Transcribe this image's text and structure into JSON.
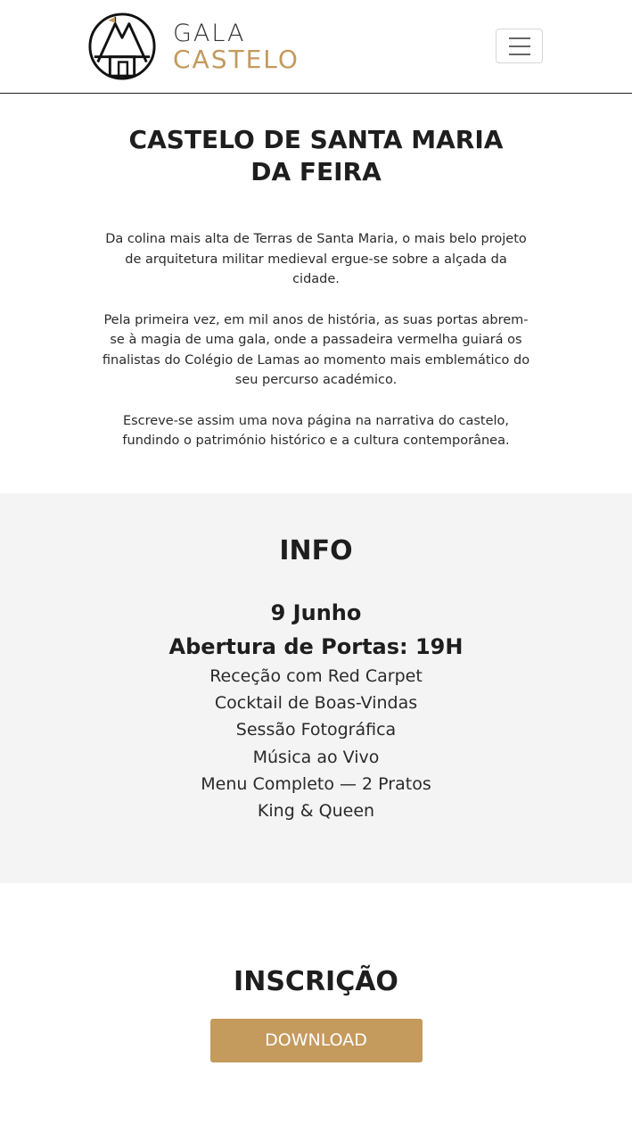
{
  "header": {
    "logo_line1": "GALA",
    "logo_line2": "CASTELO",
    "menu_icon": "hamburger-menu-icon"
  },
  "intro": {
    "title": "CASTELO DE SANTA MARIA DA FEIRA",
    "paragraphs": [
      "Da colina mais alta de Terras de Santa Maria, o mais belo projeto de arquitetura militar medieval ergue-se sobre a alçada da cidade.",
      "Pela primeira vez, em mil anos de história, as suas portas abrem-se à magia de uma gala, onde a passadeira vermelha guiará os finalistas do Colégio de Lamas ao momento mais emblemático do seu percurso académico.",
      "Escreve-se assim uma nova página na narrativa do castelo, fundindo o património histórico e a cultura contemporânea."
    ]
  },
  "info": {
    "heading": "INFO",
    "date": "9 Junho",
    "doors": "Abertura de Portas: 19H",
    "items": [
      "Receção com Red Carpet",
      "Cocktail de Boas-Vindas",
      "Sessão Fotográfica",
      "Música ao Vivo",
      "Menu Completo — 2 Pratos",
      "King & Queen"
    ]
  },
  "register": {
    "heading": "INSCRIÇÃO",
    "button_label": "DOWNLOAD"
  },
  "colors": {
    "accent_gold": "#c49a5d",
    "info_bg": "#f4f4f4",
    "text_dark": "#1e1e1e"
  }
}
